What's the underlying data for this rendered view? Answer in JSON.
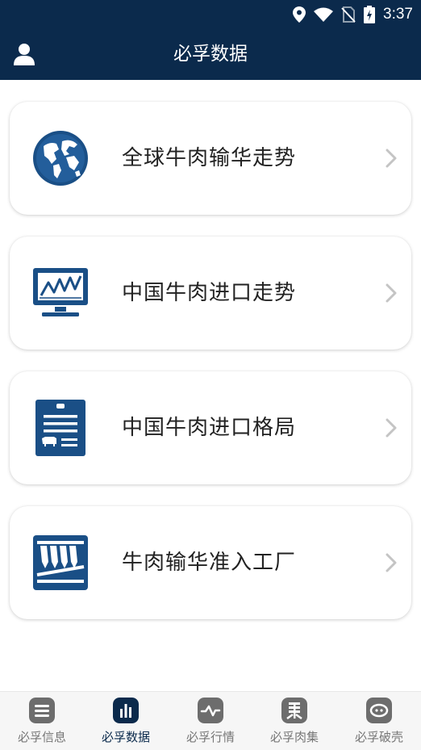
{
  "status_bar": {
    "time": "3:37"
  },
  "header": {
    "title": "必孚数据"
  },
  "cards": [
    {
      "label": "全球牛肉输华走势",
      "icon": "globe-icon"
    },
    {
      "label": "中国牛肉进口走势",
      "icon": "monitor-chart-icon"
    },
    {
      "label": "中国牛肉进口格局",
      "icon": "document-cow-icon"
    },
    {
      "label": "牛肉输华准入工厂",
      "icon": "factory-meat-icon"
    }
  ],
  "tab_bar": {
    "tabs": [
      {
        "label": "必孚信息",
        "icon": "list-icon",
        "active": false
      },
      {
        "label": "必孚数据",
        "icon": "bar-chart-icon",
        "active": true
      },
      {
        "label": "必孚行情",
        "icon": "wave-icon",
        "active": false
      },
      {
        "label": "必孚肉集",
        "icon": "collection-icon",
        "active": false
      },
      {
        "label": "必孚破壳",
        "icon": "egg-icon",
        "active": false
      }
    ]
  },
  "colors": {
    "primary": "#0b2a4c",
    "tab_inactive": "#777777",
    "icon_blue": "#1a4f86"
  }
}
